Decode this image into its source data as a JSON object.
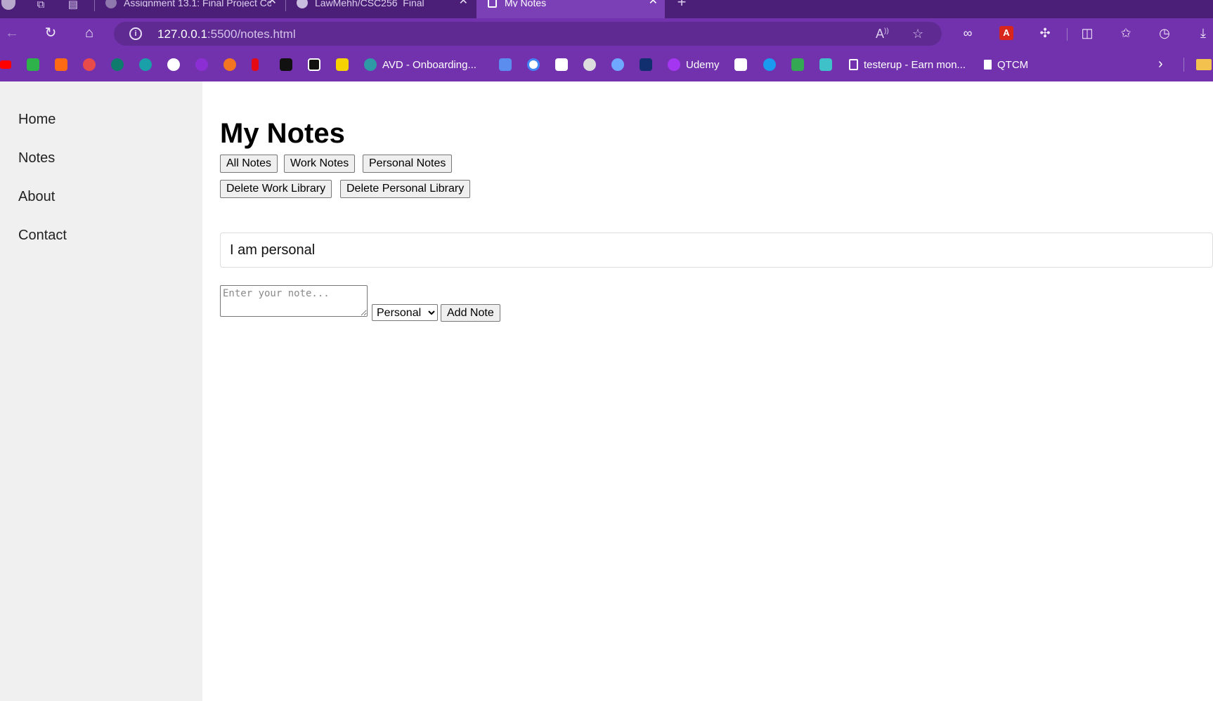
{
  "browser": {
    "tabs": [
      {
        "title": "Assignment 13.1: Final Project Co",
        "active": false
      },
      {
        "title": "LawMehh/CSC256_Final",
        "active": false
      },
      {
        "title": "My Notes",
        "active": true
      }
    ],
    "url_host": "127.0.0.1",
    "url_path": ":5500/notes.html",
    "bookmarks": [
      {
        "label": "AVD - Onboarding...",
        "color": "#2e9aa6"
      },
      {
        "label": "Udemy",
        "color": "#a435f0"
      },
      {
        "label": "testerup - Earn mon...",
        "color": "#ffffff"
      },
      {
        "label": "QTCM",
        "color": "#ffffff"
      }
    ],
    "icon_bookmarks": [
      {
        "icon": "youtube-icon",
        "color": "#ff0000"
      },
      {
        "icon": "tv-icon",
        "color": "#2db34a"
      },
      {
        "icon": "w-icon",
        "color": "#ff6a13"
      },
      {
        "icon": "star-badge-icon",
        "color": "#e94b4b"
      },
      {
        "icon": "sharepoint-icon",
        "color": "#0f7b6c"
      },
      {
        "icon": "globe-icon",
        "color": "#19a0a8"
      },
      {
        "icon": "wordpress-icon",
        "color": "#ffffff"
      },
      {
        "icon": "purple-icon",
        "color": "#8b2fd4"
      },
      {
        "icon": "crunchyroll-icon",
        "color": "#f47521"
      },
      {
        "icon": "netflix-icon",
        "color": "#e50914"
      },
      {
        "icon": "h-icon",
        "color": "#111111"
      },
      {
        "icon": "power-icon",
        "color": "#111111"
      },
      {
        "icon": "yellow-square-icon",
        "color": "#f5d200"
      }
    ]
  },
  "sidebar": {
    "items": [
      "Home",
      "Notes",
      "About",
      "Contact"
    ]
  },
  "main": {
    "title": "My Notes",
    "filter_buttons": [
      "All Notes",
      "Work Notes",
      "Personal Notes"
    ],
    "delete_buttons": [
      "Delete Work Library",
      "Delete Personal Library"
    ],
    "notes": [
      {
        "text": "I am personal"
      }
    ],
    "note_input_placeholder": "Enter your note...",
    "category_selected": "Personal",
    "category_options": [
      "Personal"
    ],
    "add_button": "Add Note"
  }
}
